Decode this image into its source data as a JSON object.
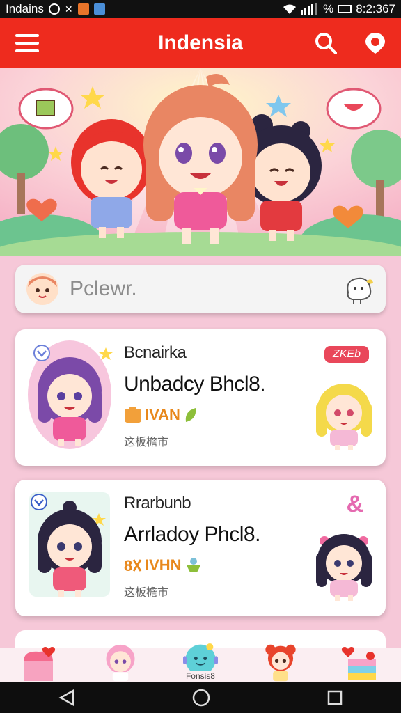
{
  "status_bar": {
    "carrier": "Indains",
    "battery": "%",
    "time": "8:2:367"
  },
  "app_bar": {
    "title": "Indensia"
  },
  "search": {
    "placeholder": "Pclewr."
  },
  "cards": [
    {
      "subtitle": "Bcnairka",
      "title": "Unbadcy Bhcl8.",
      "tagline": "IVAN",
      "meta": "这板檐市",
      "badge": "ZKEb"
    },
    {
      "subtitle": "Rrarbunb",
      "title": "Arrladoy Phcl8.",
      "tagline": "IVHN",
      "meta": "这板檐市",
      "badge": "&"
    }
  ],
  "bottom_nav": {
    "center_label": "Fonsis8"
  },
  "colors": {
    "app_bar": "#ee2b1e",
    "background": "#f6c8d8",
    "badge": "#e9475a",
    "tag_orange": "#e8881c"
  },
  "icons": [
    "menu-icon",
    "search-icon",
    "location-pin-icon",
    "home-icon",
    "profile-icon",
    "center-mascot-icon",
    "bear-icon",
    "cake-icon",
    "back-icon",
    "home-circle-icon",
    "recents-icon"
  ]
}
